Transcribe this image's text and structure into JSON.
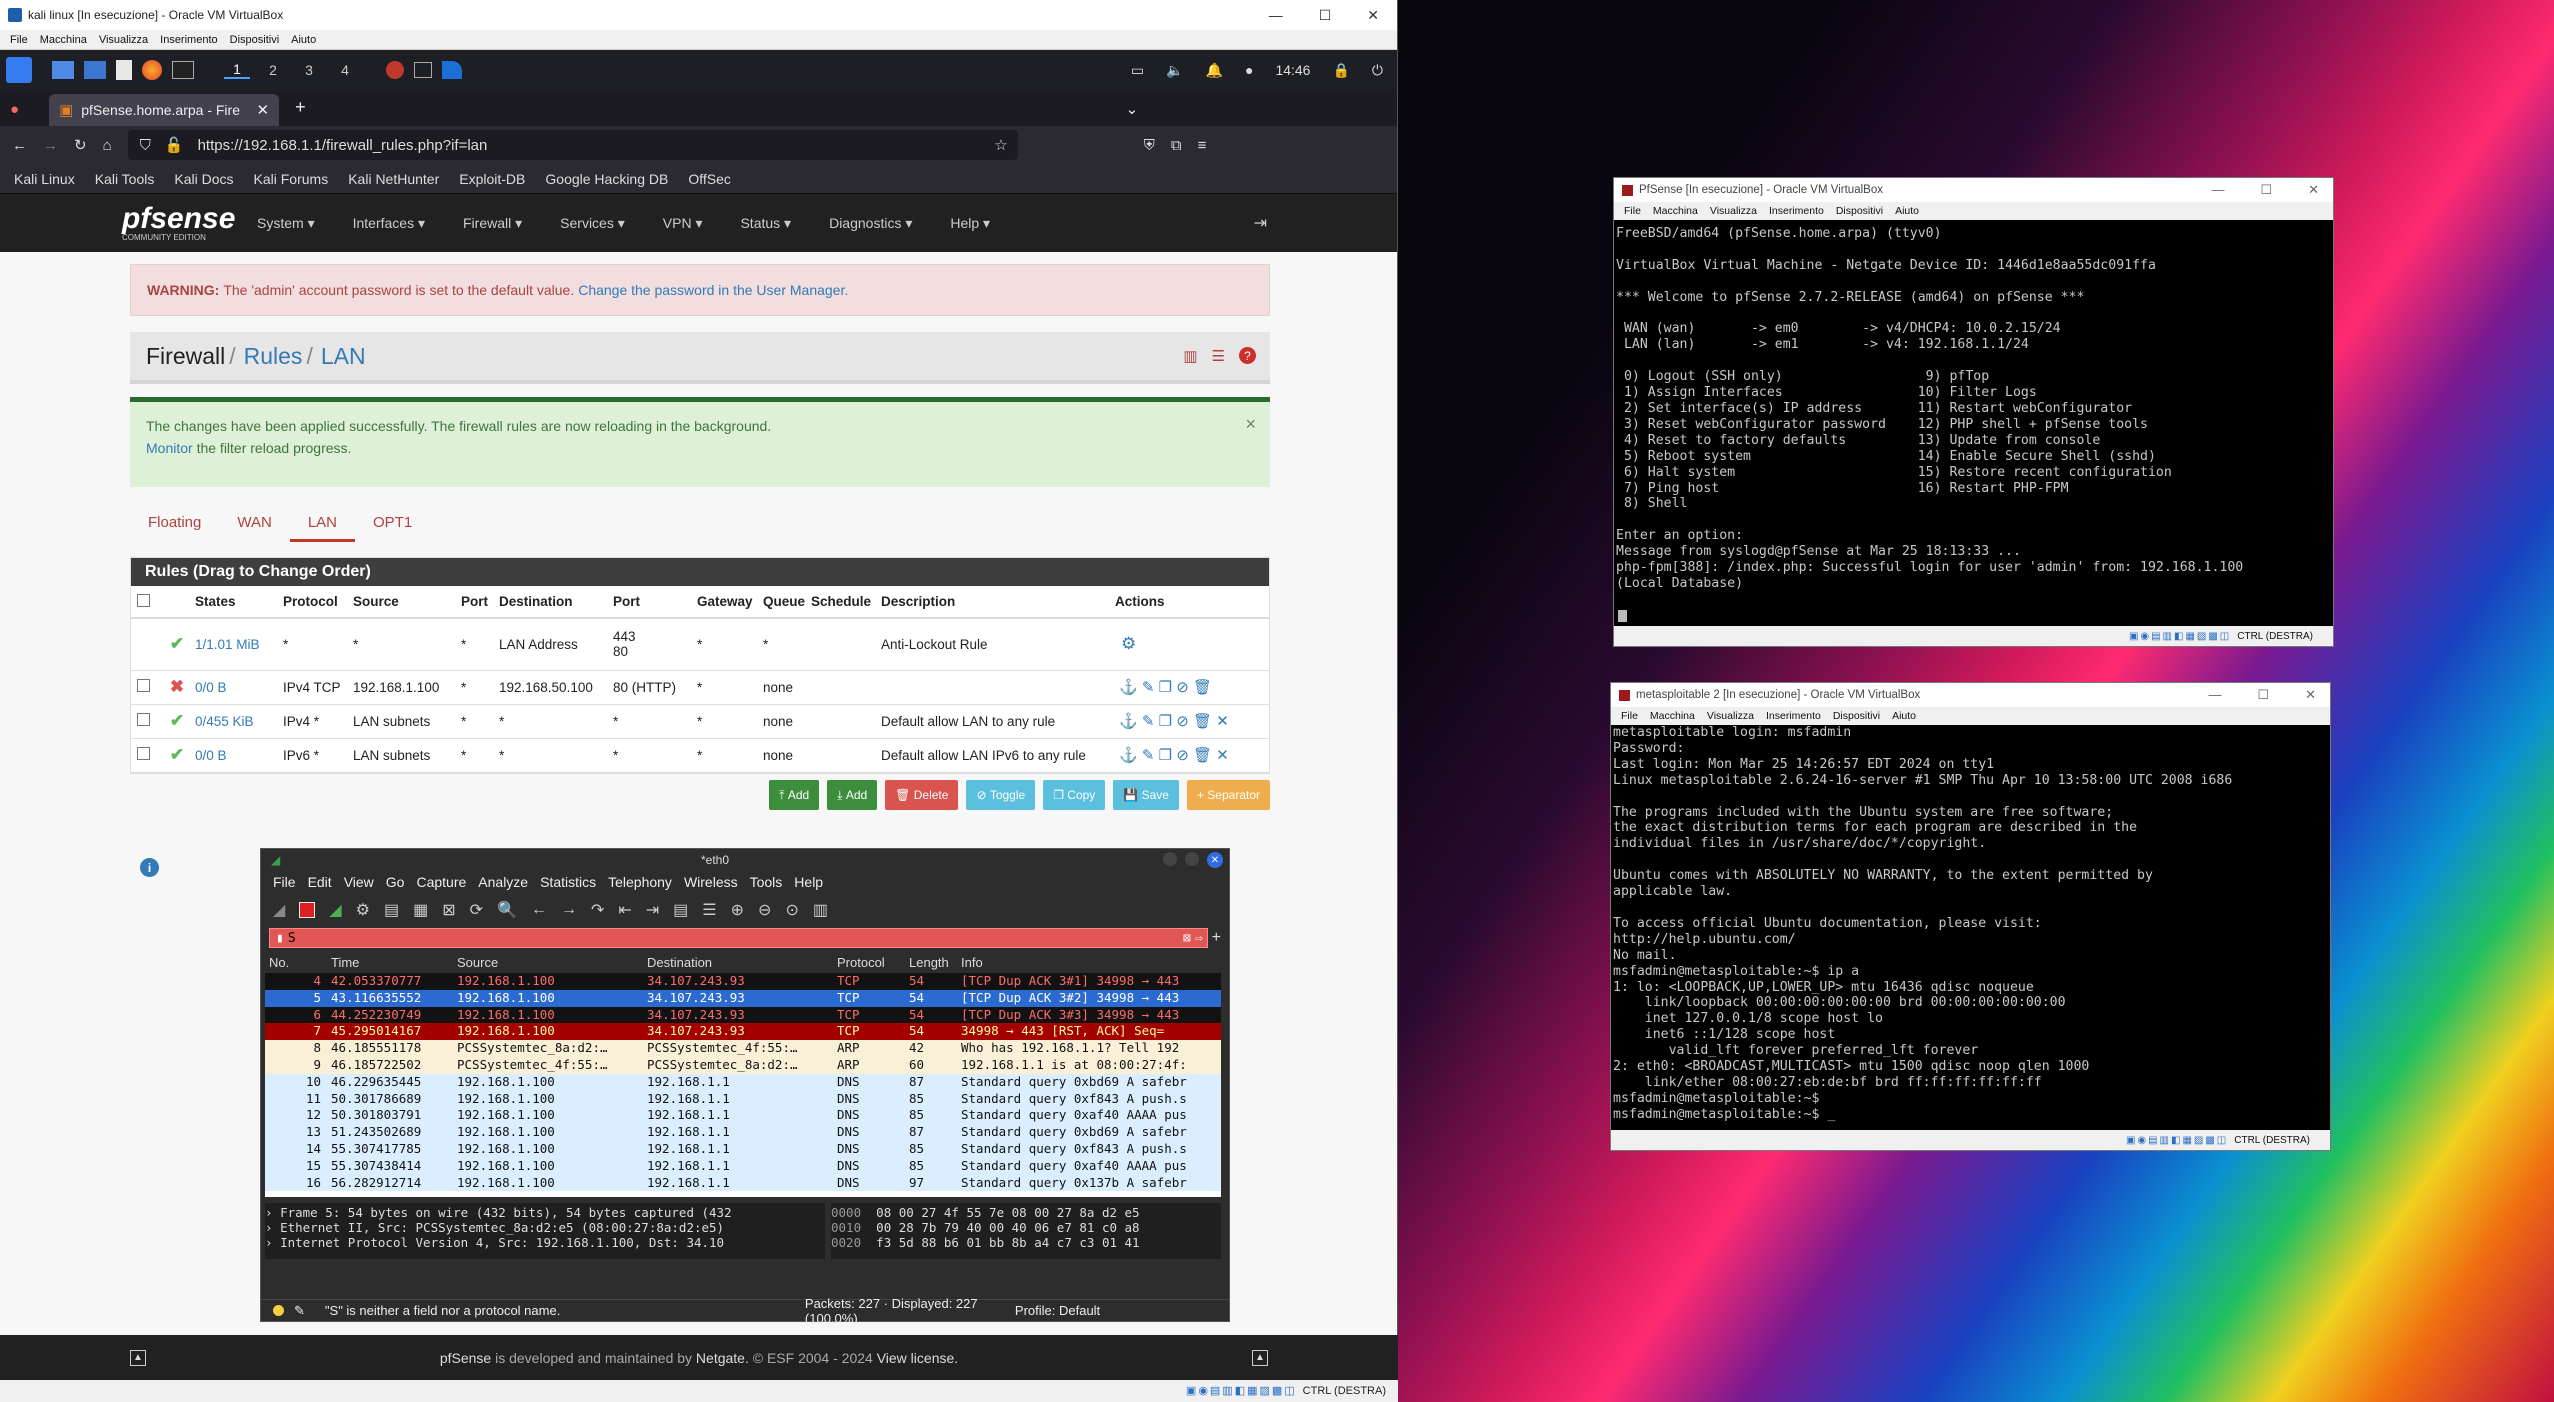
{
  "vbox_main": {
    "title": "kali linux [In esecuzione] - Oracle VM VirtualBox",
    "menu": [
      "File",
      "Macchina",
      "Visualizza",
      "Inserimento",
      "Dispositivi",
      "Aiuto"
    ],
    "status_host_key": "CTRL (DESTRA)"
  },
  "kali": {
    "workspaces": [
      "1",
      "2",
      "3",
      "4"
    ],
    "clock": "14:46"
  },
  "firefox": {
    "tab_title": "pfSense.home.arpa - Fire",
    "url": "https://192.168.1.1/firewall_rules.php?if=lan",
    "bookmarks": [
      "Kali Linux",
      "Kali Tools",
      "Kali Docs",
      "Kali Forums",
      "Kali NetHunter",
      "Exploit-DB",
      "Google Hacking DB",
      "OffSec"
    ]
  },
  "pfsense": {
    "logo": "pfsense",
    "logo_sub": "COMMUNITY EDITION",
    "nav": [
      "System ▾",
      "Interfaces ▾",
      "Firewall ▾",
      "Services ▾",
      "VPN ▾",
      "Status ▾",
      "Diagnostics ▾",
      "Help ▾"
    ],
    "warning_label": "WARNING:",
    "warning_text": "The 'admin' account password is set to the default value.",
    "warning_link": "Change the password in the User Manager.",
    "crumb": {
      "a": "Firewall",
      "b": "Rules",
      "c": "LAN",
      "sep": "/"
    },
    "success_text": "The changes have been applied successfully. The firewall rules are now reloading in the background.",
    "success_link": "Monitor",
    "success_tail": "the filter reload progress.",
    "close": "×",
    "tabs": [
      "Floating",
      "WAN",
      "LAN",
      "OPT1"
    ],
    "rules_title": "Rules (Drag to Change Order)",
    "columns": [
      "States",
      "Protocol",
      "Source",
      "Port",
      "Destination",
      "Port",
      "Gateway",
      "Queue",
      "Schedule",
      "Description",
      "Actions"
    ],
    "rows": [
      {
        "states": "1/1.01 MiB",
        "protocol": "*",
        "source": "*",
        "sport": "*",
        "dest": "LAN Address",
        "dport1": "443",
        "dport2": "80",
        "gateway": "*",
        "queue": "*",
        "schedule": "",
        "desc": "Anti-Lockout Rule",
        "status": "pass"
      },
      {
        "states": "0/0 B",
        "protocol": "IPv4 TCP",
        "source": "192.168.1.100",
        "sport": "*",
        "dest": "192.168.50.100",
        "dport1": "80 (HTTP)",
        "dport2": "",
        "gateway": "*",
        "queue": "none",
        "schedule": "",
        "desc": "",
        "status": "block"
      },
      {
        "states": "0/455 KiB",
        "protocol": "IPv4 *",
        "source": "LAN subnets",
        "sport": "*",
        "dest": "*",
        "dport1": "*",
        "dport2": "",
        "gateway": "*",
        "queue": "none",
        "schedule": "",
        "desc": "Default allow LAN to any rule",
        "status": "pass"
      },
      {
        "states": "0/0 B",
        "protocol": "IPv6 *",
        "source": "LAN subnets",
        "sport": "*",
        "dest": "*",
        "dport1": "*",
        "dport2": "",
        "gateway": "*",
        "queue": "none",
        "schedule": "",
        "desc": "Default allow LAN IPv6 to any rule",
        "status": "pass"
      }
    ],
    "buttons": [
      "Add",
      "Add",
      "Delete",
      "Toggle",
      "Copy",
      "Save",
      "Separator"
    ],
    "footer_a": "pfSense",
    "footer_b": "is developed and maintained by",
    "footer_c": "Netgate.",
    "footer_d": "© ESF 2004 - 2024",
    "footer_e": "View license."
  },
  "wireshark": {
    "title": "*eth0",
    "menu": [
      "File",
      "Edit",
      "View",
      "Go",
      "Capture",
      "Analyze",
      "Statistics",
      "Telephony",
      "Wireless",
      "Tools",
      "Help"
    ],
    "filter": "S",
    "columns": [
      "No.",
      "Time",
      "Source",
      "Destination",
      "Protocol",
      "Length",
      "Info"
    ],
    "packets": [
      {
        "no": "4",
        "time": "42.053370777",
        "src": "192.168.1.100",
        "dst": "34.107.243.93",
        "proto": "TCP",
        "len": "54",
        "info": "[TCP Dup ACK 3#1] 34998 → 443",
        "style": "bad"
      },
      {
        "no": "5",
        "time": "43.116635552",
        "src": "192.168.1.100",
        "dst": "34.107.243.93",
        "proto": "TCP",
        "len": "54",
        "info": "[TCP Dup ACK 3#2] 34998 → 443",
        "style": "sel"
      },
      {
        "no": "6",
        "time": "44.252230749",
        "src": "192.168.1.100",
        "dst": "34.107.243.93",
        "proto": "TCP",
        "len": "54",
        "info": "[TCP Dup ACK 3#3] 34998 → 443",
        "style": "bad"
      },
      {
        "no": "7",
        "time": "45.295014167",
        "src": "192.168.1.100",
        "dst": "34.107.243.93",
        "proto": "TCP",
        "len": "54",
        "info": "34998 → 443 [RST, ACK] Seq=",
        "style": "rst"
      },
      {
        "no": "8",
        "time": "46.185551178",
        "src": "PCSSystemtec_8a:d2:…",
        "dst": "PCSSystemtec_4f:55:…",
        "proto": "ARP",
        "len": "42",
        "info": "Who has 192.168.1.1? Tell 192",
        "style": "arp"
      },
      {
        "no": "9",
        "time": "46.185722502",
        "src": "PCSSystemtec_4f:55:…",
        "dst": "PCSSystemtec_8a:d2:…",
        "proto": "ARP",
        "len": "60",
        "info": "192.168.1.1 is at 08:00:27:4f:",
        "style": "arp"
      },
      {
        "no": "10",
        "time": "46.229635445",
        "src": "192.168.1.100",
        "dst": "192.168.1.1",
        "proto": "DNS",
        "len": "87",
        "info": "Standard query 0xbd69 A safebr",
        "style": "dns"
      },
      {
        "no": "11",
        "time": "50.301786689",
        "src": "192.168.1.100",
        "dst": "192.168.1.1",
        "proto": "DNS",
        "len": "85",
        "info": "Standard query 0xf843 A push.s",
        "style": "dns"
      },
      {
        "no": "12",
        "time": "50.301803791",
        "src": "192.168.1.100",
        "dst": "192.168.1.1",
        "proto": "DNS",
        "len": "85",
        "info": "Standard query 0xaf40 AAAA pus",
        "style": "dns"
      },
      {
        "no": "13",
        "time": "51.243502689",
        "src": "192.168.1.100",
        "dst": "192.168.1.1",
        "proto": "DNS",
        "len": "87",
        "info": "Standard query 0xbd69 A safebr",
        "style": "dns"
      },
      {
        "no": "14",
        "time": "55.307417785",
        "src": "192.168.1.100",
        "dst": "192.168.1.1",
        "proto": "DNS",
        "len": "85",
        "info": "Standard query 0xf843 A push.s",
        "style": "dns"
      },
      {
        "no": "15",
        "time": "55.307438414",
        "src": "192.168.1.100",
        "dst": "192.168.1.1",
        "proto": "DNS",
        "len": "85",
        "info": "Standard query 0xaf40 AAAA pus",
        "style": "dns"
      },
      {
        "no": "16",
        "time": "56.282912714",
        "src": "192.168.1.100",
        "dst": "192.168.1.1",
        "proto": "DNS",
        "len": "97",
        "info": "Standard query 0x137b A safebr",
        "style": "dns"
      }
    ],
    "details": [
      "Frame 5: 54 bytes on wire (432 bits), 54 bytes captured (432",
      "Ethernet II, Src: PCSSystemtec_8a:d2:e5 (08:00:27:8a:d2:e5)",
      "Internet Protocol Version 4, Src: 192.168.1.100, Dst: 34.10"
    ],
    "hex": [
      {
        "off": "0000",
        "bytes": "08 00 27 4f 55 7e 08 00  27 8a d2 e5"
      },
      {
        "off": "0010",
        "bytes": "00 28 7b 79 40 00 40 06  e7 81 c0 a8"
      },
      {
        "off": "0020",
        "bytes": "f3 5d 88 b6 01 bb 8b a4  c7 c3 01 41"
      }
    ],
    "status_msg": "\"S\" is neither a field nor a protocol name.",
    "status_packets": "Packets: 227 · Displayed: 227 (100.0%)",
    "status_profile": "Profile: Default"
  },
  "pfsense_vm": {
    "title": "PfSense [In esecuzione] - Oracle VM VirtualBox",
    "menu": [
      "File",
      "Macchina",
      "Visualizza",
      "Inserimento",
      "Dispositivi",
      "Aiuto"
    ],
    "console": "FreeBSD/amd64 (pfSense.home.arpa) (ttyv0)\n\nVirtualBox Virtual Machine - Netgate Device ID: 1446d1e8aa55dc091ffa\n\n*** Welcome to pfSense 2.7.2-RELEASE (amd64) on pfSense ***\n\n WAN (wan)       -> em0        -> v4/DHCP4: 10.0.2.15/24\n LAN (lan)       -> em1        -> v4: 192.168.1.1/24\n\n 0) Logout (SSH only)                  9) pfTop\n 1) Assign Interfaces                 10) Filter Logs\n 2) Set interface(s) IP address       11) Restart webConfigurator\n 3) Reset webConfigurator password    12) PHP shell + pfSense tools\n 4) Reset to factory defaults         13) Update from console\n 5) Reboot system                     14) Enable Secure Shell (sshd)\n 6) Halt system                       15) Restore recent configuration\n 7) Ping host                         16) Restart PHP-FPM\n 8) Shell\n\nEnter an option:\nMessage from syslogd@pfSense at Mar 25 18:13:33 ...\nphp-fpm[388]: /index.php: Successful login for user 'admin' from: 192.168.1.100\n(Local Database)",
    "host_key": "CTRL (DESTRA)"
  },
  "meta_vm": {
    "title": "metasploitable 2 [In esecuzione] - Oracle VM VirtualBox",
    "menu": [
      "File",
      "Macchina",
      "Visualizza",
      "Inserimento",
      "Dispositivi",
      "Aiuto"
    ],
    "console": "metasploitable login: msfadmin\nPassword:\nLast login: Mon Mar 25 14:26:57 EDT 2024 on tty1\nLinux metasploitable 2.6.24-16-server #1 SMP Thu Apr 10 13:58:00 UTC 2008 i686\n\nThe programs included with the Ubuntu system are free software;\nthe exact distribution terms for each program are described in the\nindividual files in /usr/share/doc/*/copyright.\n\nUbuntu comes with ABSOLUTELY NO WARRANTY, to the extent permitted by\napplicable law.\n\nTo access official Ubuntu documentation, please visit:\nhttp://help.ubuntu.com/\nNo mail.\nmsfadmin@metasploitable:~$ ip a\n1: lo: <LOOPBACK,UP,LOWER_UP> mtu 16436 qdisc noqueue\n    link/loopback 00:00:00:00:00:00 brd 00:00:00:00:00:00\n    inet 127.0.0.1/8 scope host lo\n    inet6 ::1/128 scope host\n       valid_lft forever preferred_lft forever\n2: eth0: <BROADCAST,MULTICAST> mtu 1500 qdisc noop qlen 1000\n    link/ether 08:00:27:eb:de:bf brd ff:ff:ff:ff:ff:ff\nmsfadmin@metasploitable:~$\nmsfadmin@metasploitable:~$ _",
    "host_key": "CTRL (DESTRA)"
  },
  "colors": {
    "pf_red": "#b0413e",
    "pf_blue": "#337ab7",
    "ws_bad": "#0a0a0a",
    "ws_sel": "#2b6ad1",
    "ws_rst": "#a40000",
    "ws_arp": "#faf0d7",
    "ws_dns": "#daeeff"
  }
}
